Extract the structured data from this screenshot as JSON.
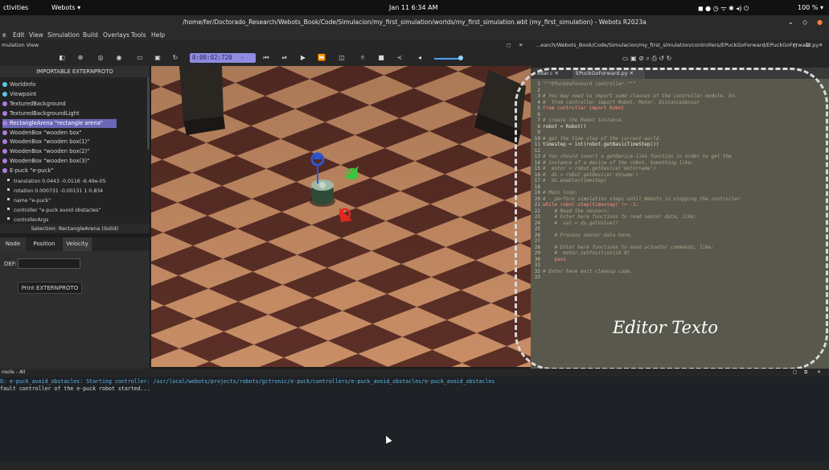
{
  "topbar": {
    "activities": "ctivities",
    "app": "Webots ▾",
    "datetime": "Jan 11  6:34 AM",
    "battery": "100 % ▾"
  },
  "window": {
    "title": "/home/fer/Doctorado_Research/Webots_Book/Code/Simulacion/my_first_simulation/worlds/my_first_simulation.wbt (my_first_simulation) - Webots R2023a"
  },
  "menu": [
    "e",
    "Edit",
    "View",
    "Simulation",
    "Build",
    "Overlays",
    "Tools",
    "Help"
  ],
  "simulation_view": {
    "label": "mulation View",
    "time": "0:00:02:720",
    "speed": "- 0.00x"
  },
  "scene_tree": {
    "header": "IMPORTABLE EXTERNPROTO",
    "nodes": [
      {
        "label": "WorldInfo",
        "color": "#5bc8e8"
      },
      {
        "label": "Viewpoint",
        "color": "#5bc8e8"
      },
      {
        "label": "TexturedBackground",
        "color": "#b07ce0"
      },
      {
        "label": "TexturedBackgroundLight",
        "color": "#b07ce0"
      },
      {
        "label": "RectangleArena \"rectangle arena\"",
        "color": "#b07ce0"
      },
      {
        "label": "WoodenBox \"wooden box\"",
        "color": "#b07ce0"
      },
      {
        "label": "WoodenBox \"wooden box(1)\"",
        "color": "#b07ce0"
      },
      {
        "label": "WoodenBox \"wooden box(2)\"",
        "color": "#b07ce0"
      },
      {
        "label": "WoodenBox \"wooden box(3)\"",
        "color": "#b07ce0"
      },
      {
        "label": "E-puck \"e-puck\"",
        "color": "#b07ce0"
      }
    ],
    "fields": [
      "translation 0.0443 -0.0116 -6.49e-05",
      "rotation 0.000731 -0.00131 1 0.834",
      "name \"e-puck\"",
      "controller \"e-puck avoid obstacles\"",
      "controllerArgs"
    ]
  },
  "selection": "Selection: RectangleArena (Solid)",
  "tabs": [
    "Node",
    "Position",
    "Velocity"
  ],
  "def_label": "DEF:",
  "print_button": "Print EXTERNPROTO",
  "editor": {
    "header_path": "...earch/Webots_Book/Code/Simulacion/my_first_simulation/controllers/EPuckGoForward/EPuckGoForward.py",
    "tabs": [
      "lidar.c",
      "EPuckGoForward.py"
    ],
    "overlay_label": "Editor Texto",
    "lines": [
      {
        "n": "1",
        "t": "\"\"\"EPuckGoForward controller.\"\"\"",
        "c": "cm"
      },
      {
        "n": "2",
        "t": "",
        "c": "tx"
      },
      {
        "n": "3",
        "t": "# You may need to import some classes of the controller module. Ex:",
        "c": "cm"
      },
      {
        "n": "4",
        "t": "#  from controller import Robot, Motor, DistanceSensor",
        "c": "cm"
      },
      {
        "n": "5",
        "t": "from controller import Robot",
        "c": "kw"
      },
      {
        "n": "6",
        "t": "",
        "c": "tx"
      },
      {
        "n": "7",
        "t": "# create the Robot instance.",
        "c": "cm"
      },
      {
        "n": "8",
        "t": "robot = Robot()",
        "c": "tx"
      },
      {
        "n": "9",
        "t": "",
        "c": "tx"
      },
      {
        "n": "10",
        "t": "# get the time step of the current world.",
        "c": "cm"
      },
      {
        "n": "11",
        "t": "timestep = int(robot.getBasicTimeStep())",
        "c": "tx"
      },
      {
        "n": "12",
        "t": "",
        "c": "tx"
      },
      {
        "n": "13",
        "t": "# You should insert a getDevice-like function in order to get the",
        "c": "cm"
      },
      {
        "n": "14",
        "t": "# instance of a device of the robot. Something like:",
        "c": "cm"
      },
      {
        "n": "15",
        "t": "#  motor = robot.getDevice('motorname')",
        "c": "cm"
      },
      {
        "n": "16",
        "t": "#  ds = robot.getDevice('dsname')",
        "c": "cm"
      },
      {
        "n": "17",
        "t": "#  ds.enable(timestep)",
        "c": "cm"
      },
      {
        "n": "18",
        "t": "",
        "c": "tx"
      },
      {
        "n": "19",
        "t": "# Main loop:",
        "c": "cm"
      },
      {
        "n": "20",
        "t": "# - perform simulation steps until Webots is stopping the controller",
        "c": "cm"
      },
      {
        "n": "21",
        "t": "while robot.step(timestep) != -1:",
        "c": "kw"
      },
      {
        "n": "22",
        "t": "    # Read the sensors:",
        "c": "cm"
      },
      {
        "n": "23",
        "t": "    # Enter here functions to read sensor data, like:",
        "c": "cm"
      },
      {
        "n": "24",
        "t": "    #  val = ds.getValue()",
        "c": "cm"
      },
      {
        "n": "25",
        "t": "",
        "c": "tx"
      },
      {
        "n": "26",
        "t": "    # Process sensor data here.",
        "c": "cm"
      },
      {
        "n": "27",
        "t": "",
        "c": "tx"
      },
      {
        "n": "28",
        "t": "    # Enter here functions to send actuator commands, like:",
        "c": "cm"
      },
      {
        "n": "29",
        "t": "    #  motor.setPosition(10.0)",
        "c": "cm"
      },
      {
        "n": "30",
        "t": "    pass",
        "c": "kw"
      },
      {
        "n": "31",
        "t": "",
        "c": "tx"
      },
      {
        "n": "32",
        "t": "# Enter here exit cleanup code.",
        "c": "cm"
      },
      {
        "n": "33",
        "t": "",
        "c": "tx"
      }
    ]
  },
  "console": {
    "label": "nsole - All",
    "lines": [
      {
        "t": "O: e-puck_avoid_obstacles: Starting controller: /usr/local/webots/projects/robots/gctronic/e-puck/controllers/e-puck_avoid_obstacles/e-puck_avoid_obstacles",
        "color": "#5fb8e8"
      },
      {
        "t": "fault controller of the e-puck robot started...",
        "color": "#d8d8d8"
      }
    ]
  },
  "colors": {
    "accent": "#6a67b5",
    "time_bg": "#8f8be0",
    "editor_bg": "#59584d"
  }
}
